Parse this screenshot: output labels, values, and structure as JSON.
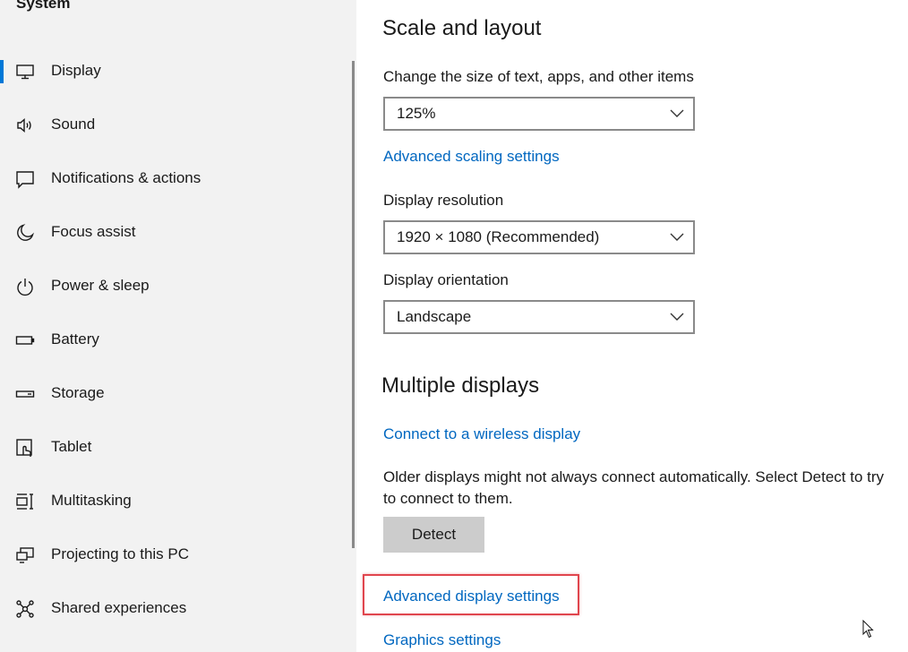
{
  "sidebar": {
    "header": "System",
    "items": [
      {
        "label": "Display",
        "icon": "monitor-icon",
        "selected": true
      },
      {
        "label": "Sound",
        "icon": "speaker-icon",
        "selected": false
      },
      {
        "label": "Notifications & actions",
        "icon": "notification-icon",
        "selected": false
      },
      {
        "label": "Focus assist",
        "icon": "moon-icon",
        "selected": false
      },
      {
        "label": "Power & sleep",
        "icon": "power-icon",
        "selected": false
      },
      {
        "label": "Battery",
        "icon": "battery-icon",
        "selected": false
      },
      {
        "label": "Storage",
        "icon": "storage-icon",
        "selected": false
      },
      {
        "label": "Tablet",
        "icon": "tablet-icon",
        "selected": false
      },
      {
        "label": "Multitasking",
        "icon": "multitasking-icon",
        "selected": false
      },
      {
        "label": "Projecting to this PC",
        "icon": "projecting-icon",
        "selected": false
      },
      {
        "label": "Shared experiences",
        "icon": "shared-experiences-icon",
        "selected": false
      }
    ]
  },
  "main": {
    "scale_section": {
      "title": "Scale and layout",
      "scale_label": "Change the size of text, apps, and other items",
      "scale_value": "125%",
      "advanced_scaling_link": "Advanced scaling settings",
      "resolution_label": "Display resolution",
      "resolution_value": "1920 × 1080 (Recommended)",
      "orientation_label": "Display orientation",
      "orientation_value": "Landscape"
    },
    "multiple_displays": {
      "title": "Multiple displays",
      "wireless_link": "Connect to a wireless display",
      "description": "Older displays might not always connect automatically. Select Detect to try to connect to them.",
      "detect_button": "Detect",
      "advanced_display_link": "Advanced display settings",
      "graphics_link": "Graphics settings"
    }
  },
  "colors": {
    "accent": "#0078d7",
    "link": "#0067c0",
    "highlight": "#e0454d"
  }
}
